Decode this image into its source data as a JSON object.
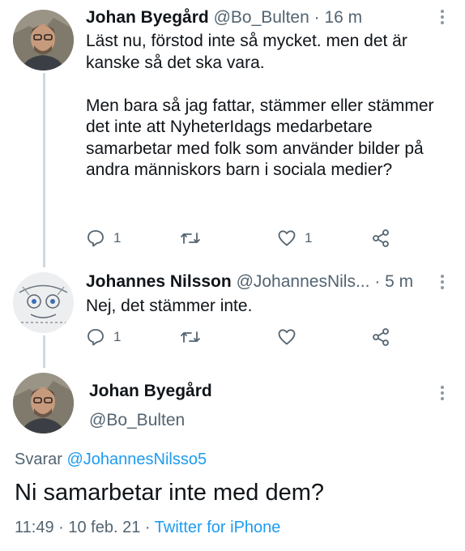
{
  "tweets": [
    {
      "name": "Johan Byegård",
      "handle": "@Bo_Bulten",
      "separator": "·",
      "time": "16 m",
      "text": "Läst nu, förstod inte så mycket. men det är kanske så det ska vara.\n\nMen bara så jag fattar, stämmer eller stämmer det inte att NyheterIdags medarbetare samarbetar med folk som använder bilder på andra människors barn i sociala medier?",
      "reply_count": "1",
      "retweet_count": "",
      "like_count": "1"
    },
    {
      "name": "Johannes Nilsson",
      "handle": "@JohannesNils...",
      "separator": "·",
      "time": "5 m",
      "text": "Nej, det stämmer inte.",
      "reply_count": "1",
      "retweet_count": "",
      "like_count": ""
    }
  ],
  "focused": {
    "name": "Johan Byegård",
    "handle": "@Bo_Bulten",
    "replying_prefix": "Svarar",
    "replying_to": "@JohannesNilsso5",
    "text": "Ni samarbetar inte med dem?",
    "time": "11:49",
    "separator": "·",
    "date": "10 feb. 21",
    "source": "Twitter for iPhone"
  },
  "icons": {
    "reply": "reply-icon",
    "retweet": "retweet-icon",
    "like": "heart-icon",
    "share": "share-icon",
    "more": "more-options-icon"
  },
  "colors": {
    "link": "#1d9bf0",
    "muted": "#536471",
    "thread_line": "#cfd9de"
  }
}
